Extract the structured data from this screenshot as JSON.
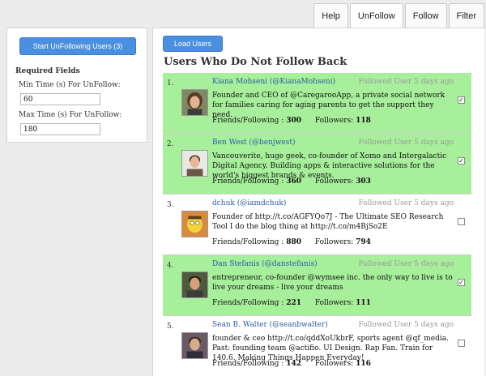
{
  "tabs": [
    {
      "label": "Help"
    },
    {
      "label": "UnFollow"
    },
    {
      "label": "Follow"
    },
    {
      "label": "Filter"
    }
  ],
  "left_panel": {
    "start_button": "Start UnFollowing Users (3)",
    "required_heading": "Required Fields",
    "min_label": "Min Time (s) For UnFollow:",
    "min_value": "60",
    "max_label": "Max Time (s) For UnFollow:",
    "max_value": "180"
  },
  "main": {
    "load_button": "Load Users",
    "heading": "Users Who Do Not Follow Back",
    "stat_labels": {
      "friends": "Friends/Following :",
      "followers": "Followers:"
    },
    "users": [
      {
        "num": "1.",
        "name": "Kiana Mohseni (@KianaMohseni)",
        "since": "Followed User 5 days ago",
        "bio": "Founder and CEO of @CaregarooApp, a private social network for families caring for aging parents to get the support they need.",
        "friends": "300",
        "followers": "118",
        "checked": true,
        "avatar_icon": "kiana-avatar-icon"
      },
      {
        "num": "2.",
        "name": "Ben West (@benjwest)",
        "since": "Followed User 5 days ago",
        "bio": "Vancouverite, huge geek, co-founder of Xomo and Intergalactic Digital Agency. Building apps & interactive solutions for the world's biggest brands & events.",
        "friends": "360",
        "followers": "303",
        "checked": true,
        "avatar_icon": "ben-avatar-icon"
      },
      {
        "num": "3.",
        "name": "dchuk (@iamdchuk)",
        "since": "Followed User 5 days ago",
        "bio": "Founder of http://t.co/AGFYQo7J - The Ultimate SEO Research Tool I do the blog thing at http://t.co/m4BjSo2E",
        "friends": "880",
        "followers": "794",
        "checked": false,
        "avatar_icon": "dchuk-avatar-icon"
      },
      {
        "num": "4.",
        "name": "Dan Stefanis (@danstefanis)",
        "since": "Followed User 5 days ago",
        "bio": "entrepreneur, co-founder @wymsee inc. the only way to live is to live your dreams - live your dreams",
        "friends": "221",
        "followers": "111",
        "checked": true,
        "avatar_icon": "dan-avatar-icon"
      },
      {
        "num": "5.",
        "name": "Sean B. Walter (@seanbwalter)",
        "since": "Followed User 5 days ago",
        "bio": "founder & ceo http://t.co/qddXoUkbrF, sports agent @qf_media. Past: founding team @actifio. UI Design. Rap Fan. Train for 140.6. Making Things Happen Everyday!",
        "friends": "142",
        "followers": "116",
        "checked": false,
        "avatar_icon": "sean-avatar-icon"
      }
    ]
  },
  "colors": {
    "highlight": "#a7ef9b",
    "button": "#4a8fe0",
    "link": "#2a5aa8"
  }
}
